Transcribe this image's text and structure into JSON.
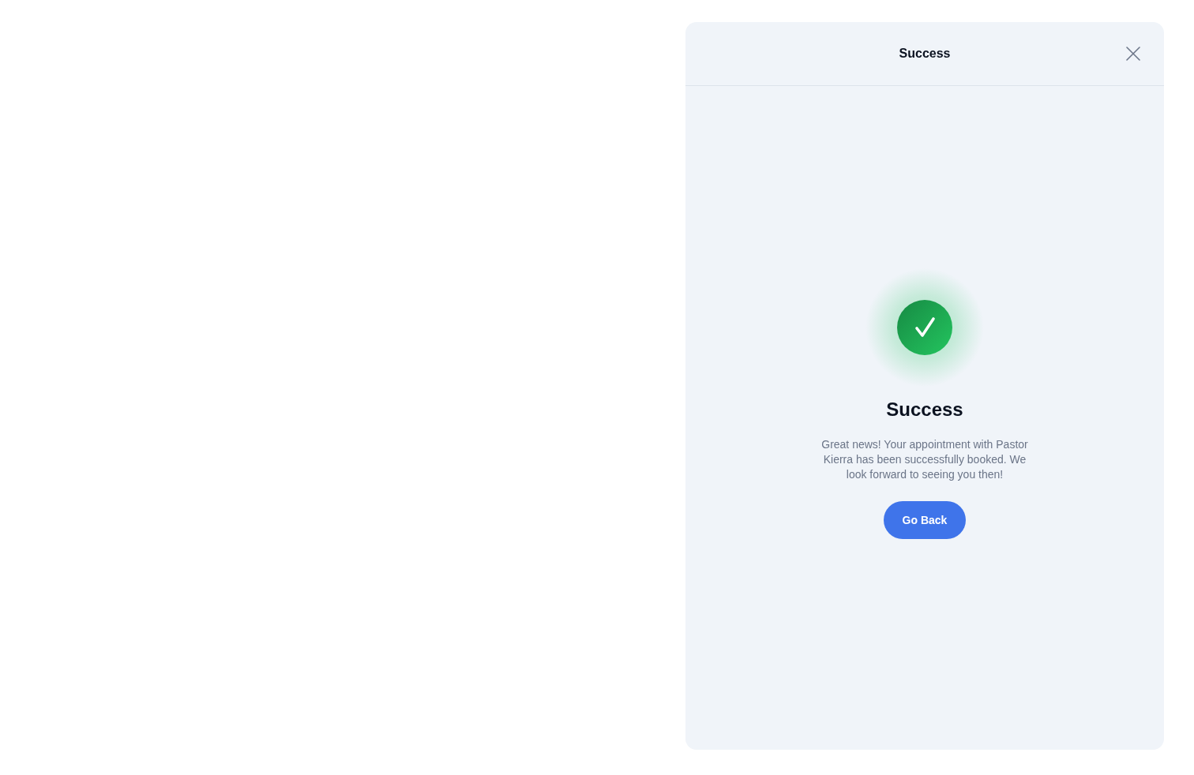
{
  "dialog": {
    "title": "Success"
  },
  "message": {
    "heading": "Success",
    "body": "Great news! Your appointment with Pastor Kierra has been successfully booked. We look forward to seeing you then!",
    "button": "Go Back"
  }
}
